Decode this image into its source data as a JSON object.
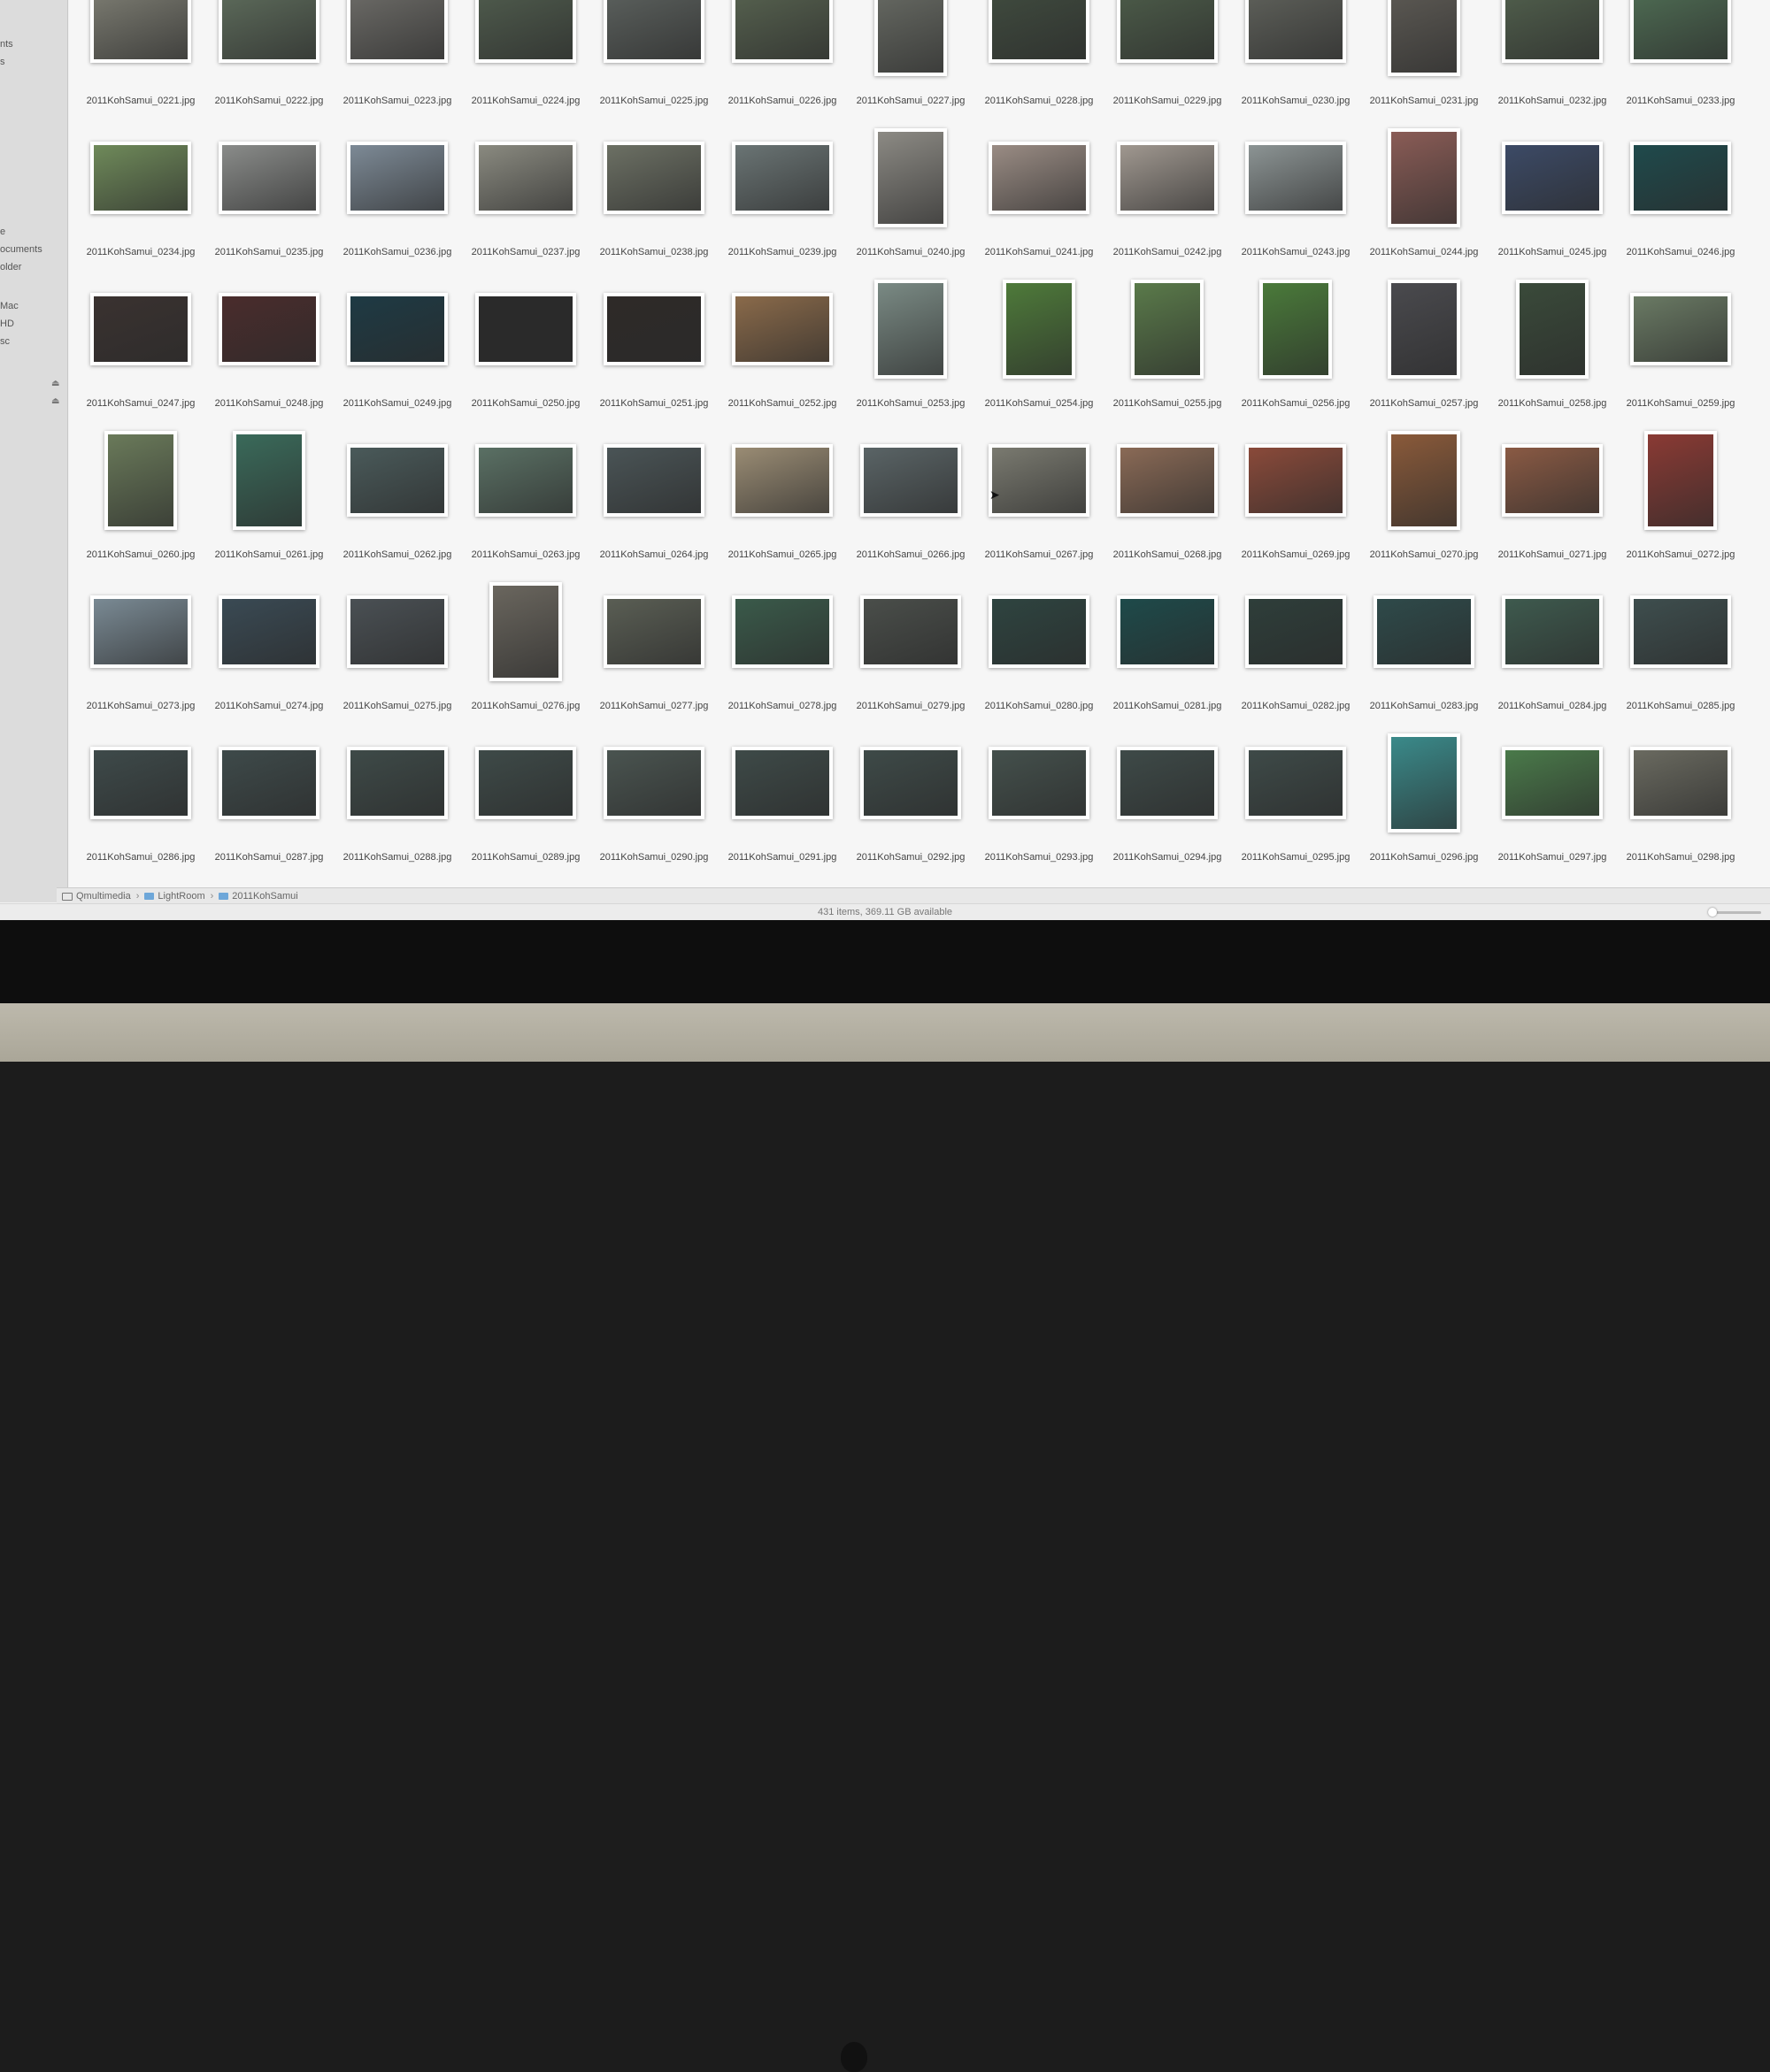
{
  "sidebar": {
    "items": [
      {
        "label": "nts"
      },
      {
        "label": "s"
      },
      {
        "label": "e"
      },
      {
        "label": "ocuments"
      },
      {
        "label": "older"
      },
      {
        "label": "Mac"
      },
      {
        "label": "HD"
      },
      {
        "label": "sc"
      }
    ]
  },
  "files": [
    {
      "name": "2011KohSamui_0221.jpg",
      "o": "l",
      "c": "#7a7a70"
    },
    {
      "name": "2011KohSamui_0222.jpg",
      "o": "l",
      "c": "#5c6a5a"
    },
    {
      "name": "2011KohSamui_0223.jpg",
      "o": "l",
      "c": "#6b6a66"
    },
    {
      "name": "2011KohSamui_0224.jpg",
      "o": "l",
      "c": "#4e5a4c"
    },
    {
      "name": "2011KohSamui_0225.jpg",
      "o": "l",
      "c": "#5a5f5c"
    },
    {
      "name": "2011KohSamui_0226.jpg",
      "o": "l",
      "c": "#55604e"
    },
    {
      "name": "2011KohSamui_0227.jpg",
      "o": "p",
      "c": "#6a6d66"
    },
    {
      "name": "2011KohSamui_0228.jpg",
      "o": "l",
      "c": "#3f4a3e"
    },
    {
      "name": "2011KohSamui_0229.jpg",
      "o": "l",
      "c": "#4b5a48"
    },
    {
      "name": "2011KohSamui_0230.jpg",
      "o": "l",
      "c": "#5d5f59"
    },
    {
      "name": "2011KohSamui_0231.jpg",
      "o": "p",
      "c": "#5f5c56"
    },
    {
      "name": "2011KohSamui_0232.jpg",
      "o": "l",
      "c": "#4f5d4b"
    },
    {
      "name": "2011KohSamui_0233.jpg",
      "o": "l",
      "c": "#4d6a52"
    },
    {
      "name": "2011KohSamui_0234.jpg",
      "o": "l",
      "c": "#6f8a5a"
    },
    {
      "name": "2011KohSamui_0235.jpg",
      "o": "l",
      "c": "#8a8c8a"
    },
    {
      "name": "2011KohSamui_0236.jpg",
      "o": "l",
      "c": "#7d8a96"
    },
    {
      "name": "2011KohSamui_0237.jpg",
      "o": "l",
      "c": "#8a8a80"
    },
    {
      "name": "2011KohSamui_0238.jpg",
      "o": "l",
      "c": "#6c7064"
    },
    {
      "name": "2011KohSamui_0239.jpg",
      "o": "l",
      "c": "#6a7474"
    },
    {
      "name": "2011KohSamui_0240.jpg",
      "o": "p",
      "c": "#8c8a84"
    },
    {
      "name": "2011KohSamui_0241.jpg",
      "o": "l",
      "c": "#9a8c84"
    },
    {
      "name": "2011KohSamui_0242.jpg",
      "o": "l",
      "c": "#a09890"
    },
    {
      "name": "2011KohSamui_0243.jpg",
      "o": "l",
      "c": "#8c9494"
    },
    {
      "name": "2011KohSamui_0244.jpg",
      "o": "p",
      "c": "#8a5c56"
    },
    {
      "name": "2011KohSamui_0245.jpg",
      "o": "l",
      "c": "#3c4a66"
    },
    {
      "name": "2011KohSamui_0246.jpg",
      "o": "l",
      "c": "#1f4a4c"
    },
    {
      "name": "2011KohSamui_0247.jpg",
      "o": "l",
      "c": "#3a3230"
    },
    {
      "name": "2011KohSamui_0248.jpg",
      "o": "l",
      "c": "#4a2c2c"
    },
    {
      "name": "2011KohSamui_0249.jpg",
      "o": "l",
      "c": "#1e3a44"
    },
    {
      "name": "2011KohSamui_0250.jpg",
      "o": "l",
      "c": "#2a2a2a"
    },
    {
      "name": "2011KohSamui_0251.jpg",
      "o": "l",
      "c": "#2e2a28"
    },
    {
      "name": "2011KohSamui_0252.jpg",
      "o": "l",
      "c": "#8a6a4a"
    },
    {
      "name": "2011KohSamui_0253.jpg",
      "o": "p",
      "c": "#7a8a84"
    },
    {
      "name": "2011KohSamui_0254.jpg",
      "o": "p",
      "c": "#4e7a3a"
    },
    {
      "name": "2011KohSamui_0255.jpg",
      "o": "p",
      "c": "#5a7a4a"
    },
    {
      "name": "2011KohSamui_0256.jpg",
      "o": "p",
      "c": "#4a7a3a"
    },
    {
      "name": "2011KohSamui_0257.jpg",
      "o": "p",
      "c": "#4a4a4e"
    },
    {
      "name": "2011KohSamui_0258.jpg",
      "o": "p",
      "c": "#3a4a3a"
    },
    {
      "name": "2011KohSamui_0259.jpg",
      "o": "l",
      "c": "#6a7a64"
    },
    {
      "name": "2011KohSamui_0260.jpg",
      "o": "p",
      "c": "#6a7a5a"
    },
    {
      "name": "2011KohSamui_0261.jpg",
      "o": "p",
      "c": "#3a6a5a"
    },
    {
      "name": "2011KohSamui_0262.jpg",
      "o": "l",
      "c": "#4a5a5a"
    },
    {
      "name": "2011KohSamui_0263.jpg",
      "o": "l",
      "c": "#5a7064"
    },
    {
      "name": "2011KohSamui_0264.jpg",
      "o": "l",
      "c": "#4a5456"
    },
    {
      "name": "2011KohSamui_0265.jpg",
      "o": "l",
      "c": "#9a8c74"
    },
    {
      "name": "2011KohSamui_0266.jpg",
      "o": "l",
      "c": "#5a6466"
    },
    {
      "name": "2011KohSamui_0267.jpg",
      "o": "l",
      "c": "#7a7a70"
    },
    {
      "name": "2011KohSamui_0268.jpg",
      "o": "l",
      "c": "#8a6a56"
    },
    {
      "name": "2011KohSamui_0269.jpg",
      "o": "l",
      "c": "#8a4a3a"
    },
    {
      "name": "2011KohSamui_0270.jpg",
      "o": "p",
      "c": "#8a5a3a"
    },
    {
      "name": "2011KohSamui_0271.jpg",
      "o": "l",
      "c": "#8a5a44"
    },
    {
      "name": "2011KohSamui_0272.jpg",
      "o": "p",
      "c": "#8a3a34"
    },
    {
      "name": "2011KohSamui_0273.jpg",
      "o": "l",
      "c": "#7a8a94"
    },
    {
      "name": "2011KohSamui_0274.jpg",
      "o": "l",
      "c": "#3a4a54"
    },
    {
      "name": "2011KohSamui_0275.jpg",
      "o": "l",
      "c": "#4a5054"
    },
    {
      "name": "2011KohSamui_0276.jpg",
      "o": "p",
      "c": "#6a665e"
    },
    {
      "name": "2011KohSamui_0277.jpg",
      "o": "l",
      "c": "#5a5e54"
    },
    {
      "name": "2011KohSamui_0278.jpg",
      "o": "l",
      "c": "#3a5a4a"
    },
    {
      "name": "2011KohSamui_0279.jpg",
      "o": "l",
      "c": "#4a4e4a"
    },
    {
      "name": "2011KohSamui_0280.jpg",
      "o": "l",
      "c": "#2e4440"
    },
    {
      "name": "2011KohSamui_0281.jpg",
      "o": "l",
      "c": "#1e4a4a"
    },
    {
      "name": "2011KohSamui_0282.jpg",
      "o": "l",
      "c": "#2e3e3a"
    },
    {
      "name": "2011KohSamui_0283.jpg",
      "o": "l",
      "c": "#2e4a4a"
    },
    {
      "name": "2011KohSamui_0284.jpg",
      "o": "l",
      "c": "#3e5a4e"
    },
    {
      "name": "2011KohSamui_0285.jpg",
      "o": "l",
      "c": "#3e4e4e"
    },
    {
      "name": "2011KohSamui_0286.jpg",
      "o": "l",
      "c": "#3e4a4a"
    },
    {
      "name": "2011KohSamui_0287.jpg",
      "o": "l",
      "c": "#3e4a4a"
    },
    {
      "name": "2011KohSamui_0288.jpg",
      "o": "l",
      "c": "#3e4a48"
    },
    {
      "name": "2011KohSamui_0289.jpg",
      "o": "l",
      "c": "#3e4a48"
    },
    {
      "name": "2011KohSamui_0290.jpg",
      "o": "l",
      "c": "#4a5450"
    },
    {
      "name": "2011KohSamui_0291.jpg",
      "o": "l",
      "c": "#3e4a48"
    },
    {
      "name": "2011KohSamui_0292.jpg",
      "o": "l",
      "c": "#3e4a48"
    },
    {
      "name": "2011KohSamui_0293.jpg",
      "o": "l",
      "c": "#44504c"
    },
    {
      "name": "2011KohSamui_0294.jpg",
      "o": "l",
      "c": "#3e4a48"
    },
    {
      "name": "2011KohSamui_0295.jpg",
      "o": "l",
      "c": "#3e4a48"
    },
    {
      "name": "2011KohSamui_0296.jpg",
      "o": "p",
      "c": "#3a8a8a"
    },
    {
      "name": "2011KohSamui_0297.jpg",
      "o": "l",
      "c": "#4a7a4a"
    },
    {
      "name": "2011KohSamui_0298.jpg",
      "o": "l",
      "c": "#6a6a60"
    },
    {
      "name": "",
      "o": "l",
      "c": "#5a6458"
    },
    {
      "name": "",
      "o": "l",
      "c": "#5a6458"
    },
    {
      "name": "",
      "o": "l",
      "c": "#5a6458"
    },
    {
      "name": "",
      "o": "l",
      "c": "#5a6458"
    },
    {
      "name": "",
      "o": "l",
      "c": "#5a6458"
    },
    {
      "name": "",
      "o": "l",
      "c": "#5a6458"
    },
    {
      "name": "",
      "o": "l",
      "c": "#5a6458"
    },
    {
      "name": "",
      "o": "l",
      "c": "#5a6458"
    },
    {
      "name": "",
      "o": "l",
      "c": "#5a6458"
    },
    {
      "name": "",
      "o": "l",
      "c": "#4a5a48"
    },
    {
      "name": "",
      "o": "l",
      "c": "#4a5a48"
    },
    {
      "name": "",
      "o": "l",
      "c": "#4a5a48"
    },
    {
      "name": "",
      "o": "l",
      "c": "#4a5a48"
    }
  ],
  "pathbar": {
    "root": "Qmultimedia",
    "folder1": "LightRoom",
    "folder2": "2011KohSamui"
  },
  "status": {
    "text": "431 items, 369.11 GB available"
  },
  "icons": {
    "folder": "folder-icon",
    "drive": "drive-icon",
    "eject": "eject-icon",
    "cursor": "mouse-pointer-icon"
  },
  "colors": {
    "folder_blue": "#6ea7d9",
    "window_bg": "#f6f6f6"
  }
}
